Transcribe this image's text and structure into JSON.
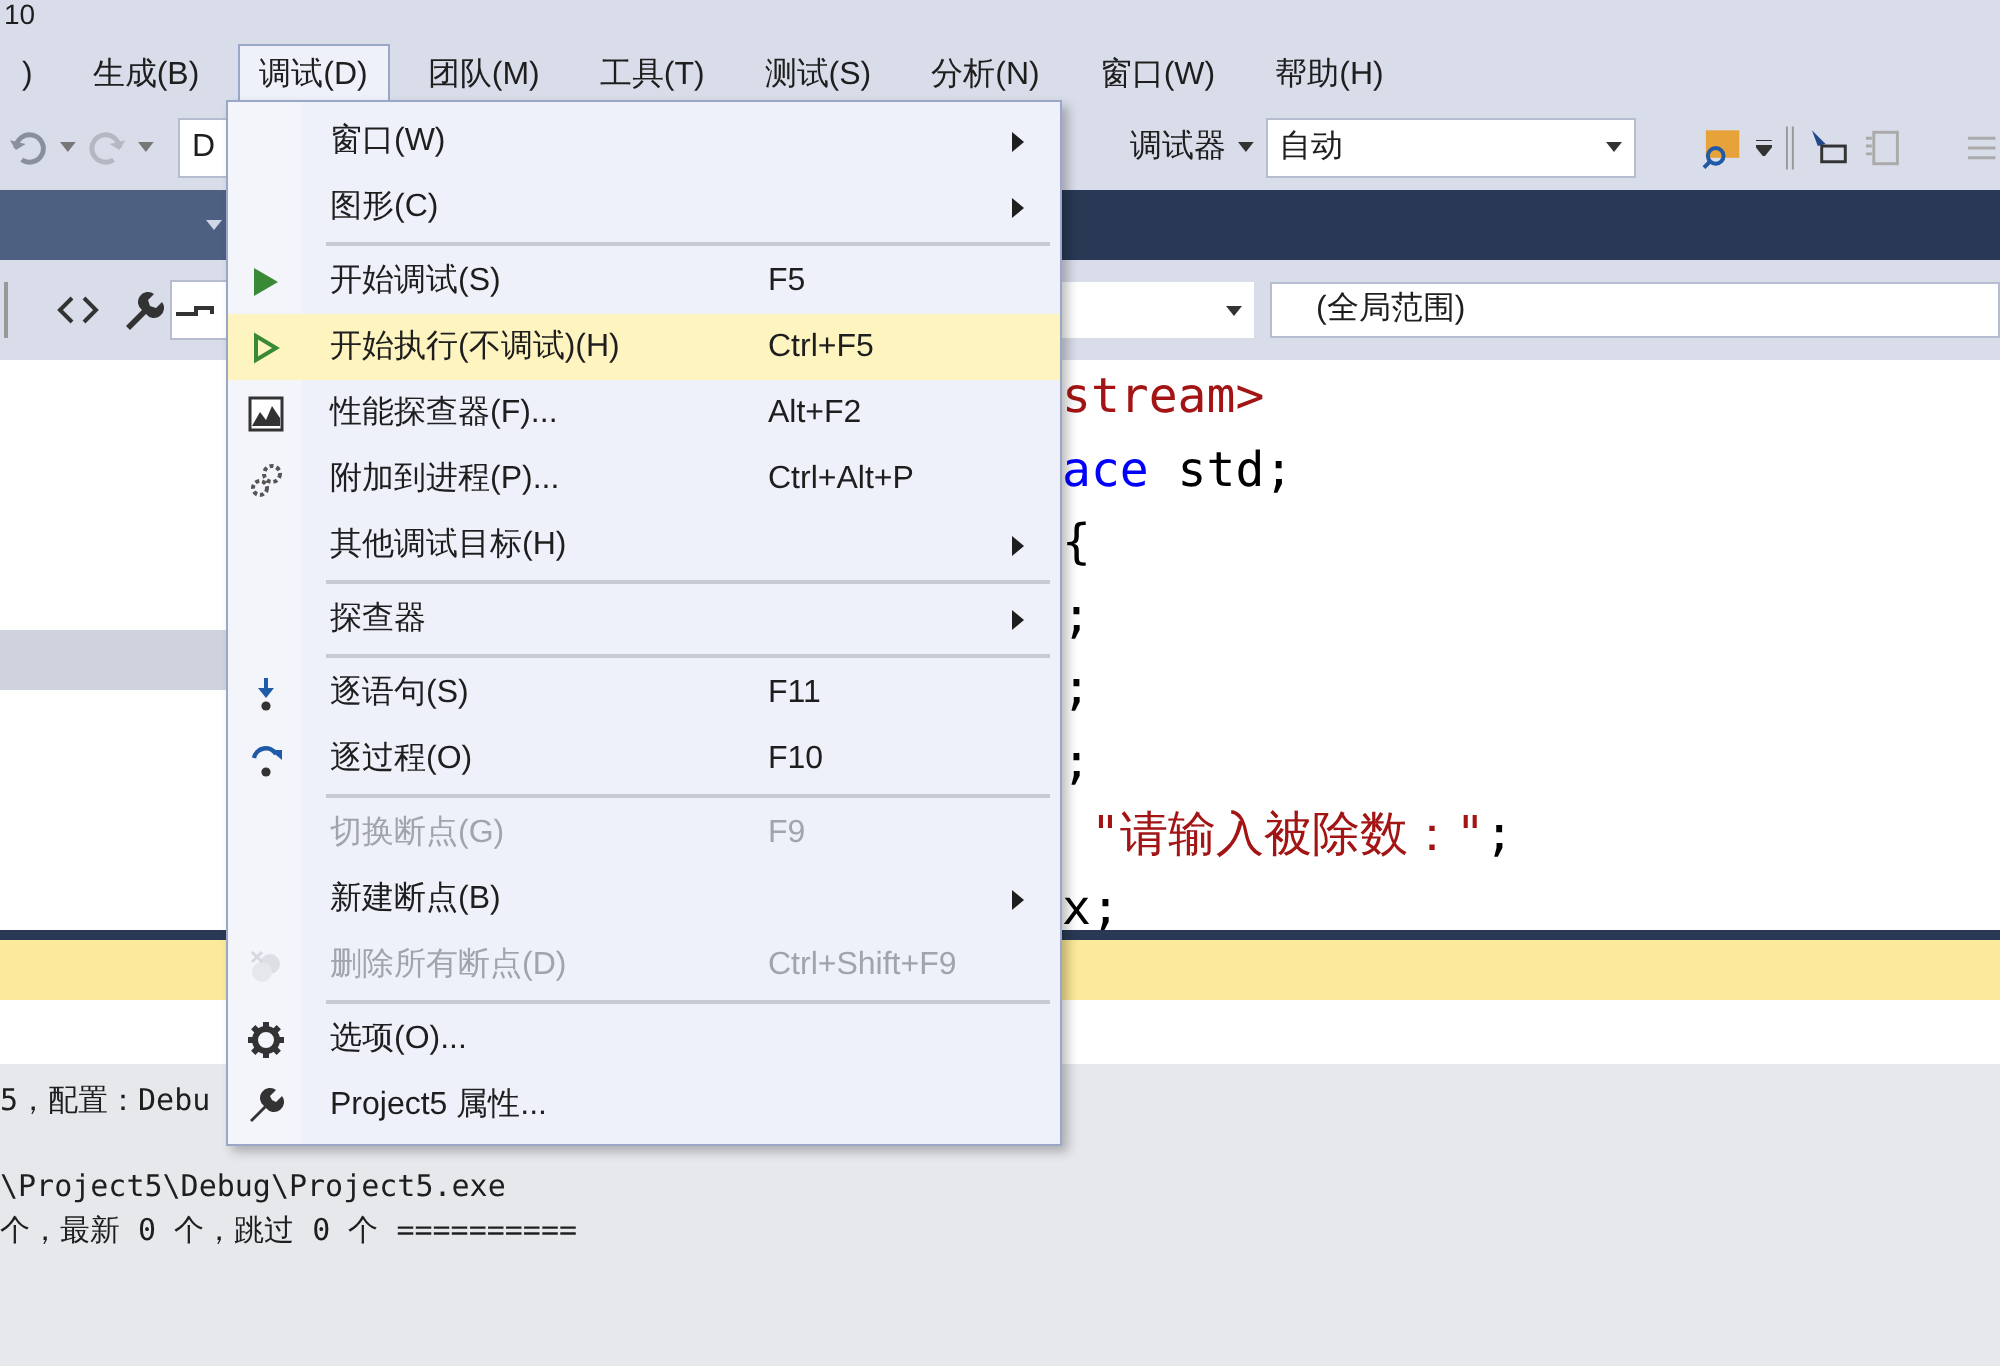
{
  "window": {
    "title": "10"
  },
  "menubar": [
    {
      "label": ")",
      "selected": false
    },
    {
      "label": "生成(B)",
      "selected": false
    },
    {
      "label": "调试(D)",
      "selected": true
    },
    {
      "label": "团队(M)",
      "selected": false
    },
    {
      "label": "工具(T)",
      "selected": false
    },
    {
      "label": "测试(S)",
      "selected": false
    },
    {
      "label": "分析(N)",
      "selected": false
    },
    {
      "label": "窗口(W)",
      "selected": false
    },
    {
      "label": "帮助(H)",
      "selected": false
    }
  ],
  "toolbar": {
    "config_combo": "D",
    "debugger_label": "调试器",
    "target_combo": "自动"
  },
  "navigation_bar": {
    "scope_combo": "(全局范围)"
  },
  "code_lines": [
    [
      {
        "text": "stream>",
        "kind": "string"
      }
    ],
    [
      {
        "text": "ace",
        "kind": "keyword"
      },
      {
        "text": " std;",
        "kind": "plain"
      }
    ],
    [
      {
        "text": "{",
        "kind": "plain"
      }
    ],
    [
      {
        "text": ";",
        "kind": "plain"
      }
    ],
    [
      {
        "text": ";",
        "kind": "plain"
      }
    ],
    [
      {
        "text": ";",
        "kind": "plain"
      }
    ],
    [
      {
        "text": " \"请输入被除数：\"",
        "kind": "string"
      },
      {
        "text": ";",
        "kind": "plain"
      }
    ],
    [
      {
        "text": "x;",
        "kind": "plain"
      }
    ]
  ],
  "output": {
    "lines": [
      "5，配置：Debu",
      "\\Project5\\Debug\\Project5.exe",
      "个，最新 0 个，跳过 0 个 =========="
    ]
  },
  "debug_menu": {
    "items": [
      {
        "kind": "item",
        "label": "窗口(W)",
        "submenu": true,
        "disabled": false,
        "highlighted": false
      },
      {
        "kind": "item",
        "label": "图形(C)",
        "submenu": true,
        "disabled": false,
        "highlighted": false
      },
      {
        "kind": "separator"
      },
      {
        "kind": "item",
        "label": "开始调试(S)",
        "shortcut": "F5",
        "submenu": false,
        "disabled": false,
        "highlighted": false
      },
      {
        "kind": "item",
        "label": "开始执行(不调试)(H)",
        "shortcut": "Ctrl+F5",
        "submenu": false,
        "disabled": false,
        "highlighted": true
      },
      {
        "kind": "item",
        "label": "性能探查器(F)...",
        "shortcut": "Alt+F2",
        "submenu": false,
        "disabled": false,
        "highlighted": false
      },
      {
        "kind": "item",
        "label": "附加到进程(P)...",
        "shortcut": "Ctrl+Alt+P",
        "submenu": false,
        "disabled": false,
        "highlighted": false
      },
      {
        "kind": "item",
        "label": "其他调试目标(H)",
        "submenu": true,
        "disabled": false,
        "highlighted": false
      },
      {
        "kind": "separator"
      },
      {
        "kind": "item",
        "label": "探查器",
        "submenu": true,
        "disabled": false,
        "highlighted": false
      },
      {
        "kind": "separator"
      },
      {
        "kind": "item",
        "label": "逐语句(S)",
        "shortcut": "F11",
        "submenu": false,
        "disabled": false,
        "highlighted": false
      },
      {
        "kind": "item",
        "label": "逐过程(O)",
        "shortcut": "F10",
        "submenu": false,
        "disabled": false,
        "highlighted": false
      },
      {
        "kind": "separator"
      },
      {
        "kind": "item",
        "label": "切换断点(G)",
        "shortcut": "F9",
        "submenu": false,
        "disabled": true,
        "highlighted": false
      },
      {
        "kind": "item",
        "label": "新建断点(B)",
        "submenu": true,
        "disabled": false,
        "highlighted": false
      },
      {
        "kind": "item",
        "label": "删除所有断点(D)",
        "shortcut": "Ctrl+Shift+F9",
        "submenu": false,
        "disabled": true,
        "highlighted": false
      },
      {
        "kind": "separator"
      },
      {
        "kind": "item",
        "label": "选项(O)...",
        "submenu": false,
        "disabled": false,
        "highlighted": false
      },
      {
        "kind": "item",
        "label": "Project5 属性...",
        "submenu": false,
        "disabled": false,
        "highlighted": false
      }
    ]
  }
}
